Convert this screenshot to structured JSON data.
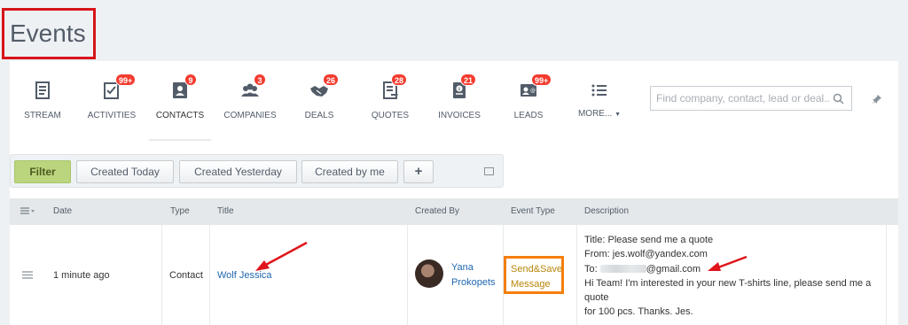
{
  "page": {
    "title": "Events"
  },
  "nav": {
    "items": [
      {
        "label": "STREAM",
        "icon": "stream-icon",
        "badge": ""
      },
      {
        "label": "ACTIVITIES",
        "icon": "activities-icon",
        "badge": "99+"
      },
      {
        "label": "CONTACTS",
        "icon": "contacts-icon",
        "badge": "9"
      },
      {
        "label": "COMPANIES",
        "icon": "companies-icon",
        "badge": "3"
      },
      {
        "label": "DEALS",
        "icon": "deals-icon",
        "badge": "26"
      },
      {
        "label": "QUOTES",
        "icon": "quotes-icon",
        "badge": "28"
      },
      {
        "label": "INVOICES",
        "icon": "invoices-icon",
        "badge": "21"
      },
      {
        "label": "LEADS",
        "icon": "leads-icon",
        "badge": "99+"
      },
      {
        "label": "MORE...",
        "icon": "more-list-icon",
        "badge": ""
      }
    ],
    "active": "CONTACTS"
  },
  "search": {
    "placeholder": "Find company, contact, lead or deal..."
  },
  "filters": {
    "filter_label": "Filter",
    "buttons": [
      "Created Today",
      "Created Yesterday",
      "Created by me"
    ],
    "add_label": "+"
  },
  "table": {
    "columns": [
      "Date",
      "Type",
      "Title",
      "Created By",
      "Event Type",
      "Description"
    ],
    "rows": [
      {
        "date": "1 minute ago",
        "type": "Contact",
        "title": "Wolf Jessica",
        "created_by_first": "Yana",
        "created_by_last": "Prokopets",
        "event_type_line1": "Send&Save",
        "event_type_line2": "Message",
        "description": {
          "line1": "Title: Please send me a quote",
          "line2": "From: jes.wolf@yandex.com",
          "line3_prefix": "To:",
          "line3_suffix": "@gmail.com",
          "line4": "Hi Team! I'm interested in your new T-shirts line, please send me a",
          "line5": "quote",
          "line6": "for 100 pcs. Thanks. Jes."
        }
      }
    ]
  },
  "colors": {
    "accent_red": "#d7141b",
    "badge_red": "#f33b2e",
    "filter_green": "#bbd57e",
    "highlight_orange": "#f57f0e",
    "link_blue": "#2067b0"
  }
}
